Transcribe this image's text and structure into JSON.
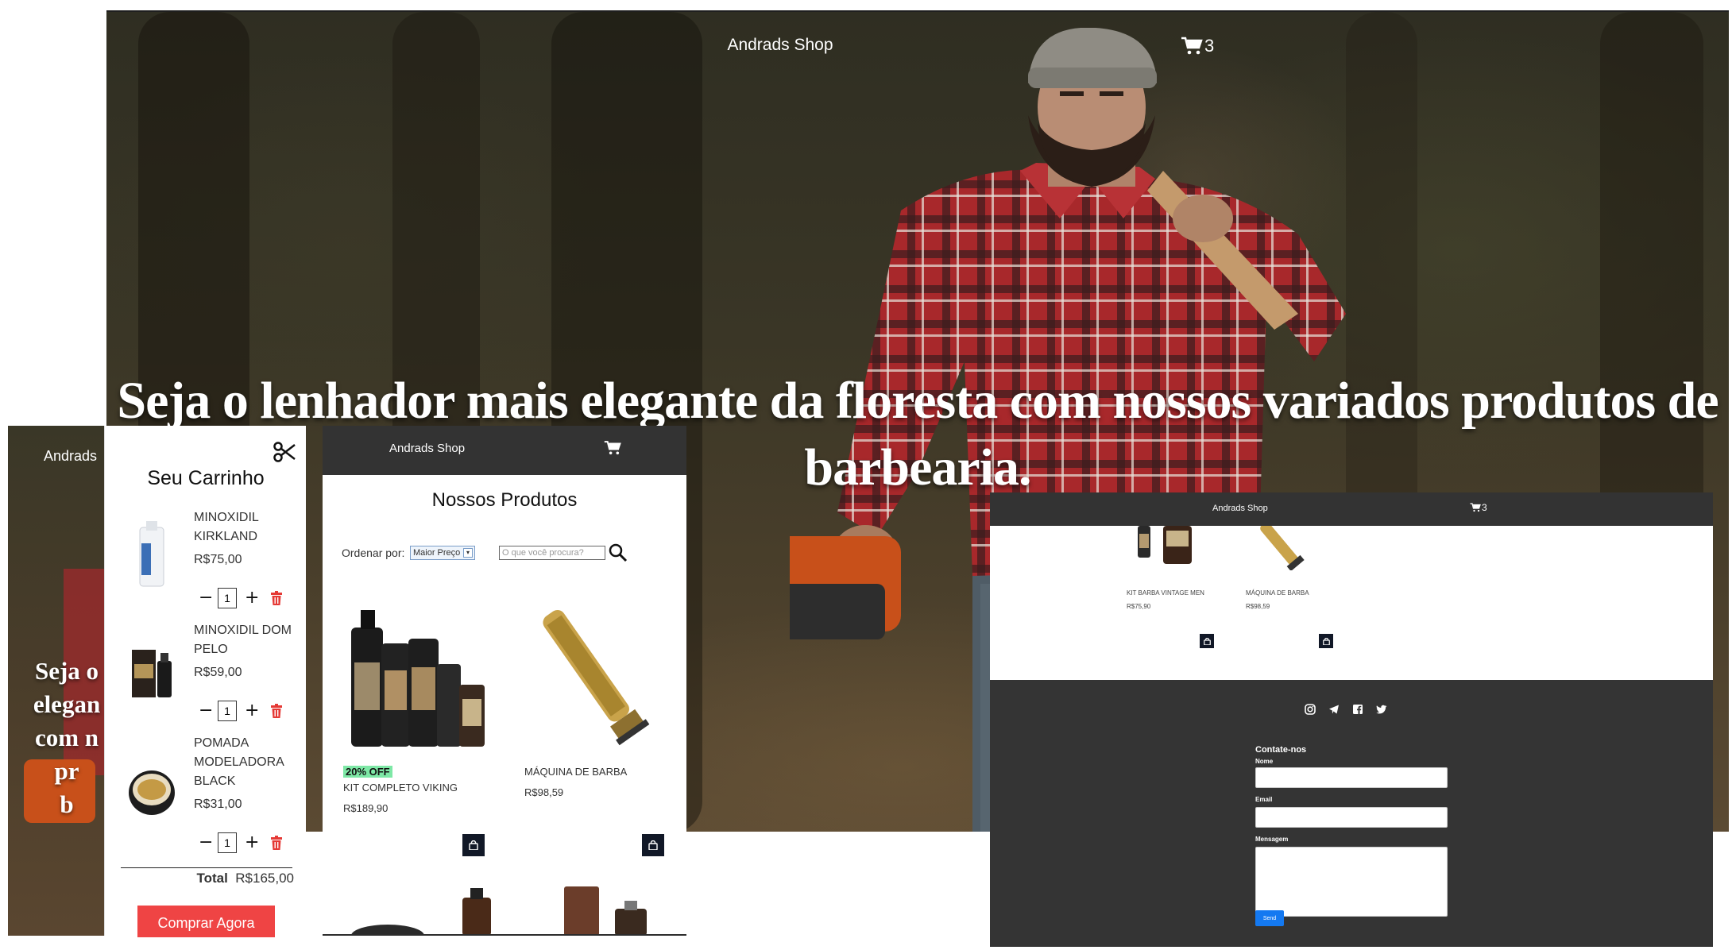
{
  "hero": {
    "brand": "Andrads Shop",
    "cart_count": "3",
    "headline": "Seja o lenhador mais elegante da floresta com nossos variados produtos de barbearia."
  },
  "mobile_hero": {
    "brand": "Andrads",
    "text_lines": [
      "Seja o",
      "elegan",
      "com n",
      "pr",
      "b"
    ]
  },
  "cart": {
    "title": "Seu Carrinho",
    "items": [
      {
        "name": "MINOXIDIL KIRKLAND",
        "price": "R$75,00",
        "qty": "1"
      },
      {
        "name": "MINOXIDIL DOM PELO",
        "price": "R$59,00",
        "qty": "1"
      },
      {
        "name": "POMADA MODELADORA BLACK",
        "price": "R$31,00",
        "qty": "1"
      }
    ],
    "total_label": "Total",
    "total_value": "R$165,00",
    "buy_label": "Comprar Agora"
  },
  "products": {
    "brand": "Andrads Shop",
    "title": "Nossos Produtos",
    "sort_label": "Ordenar por:",
    "sort_value": "Maior Preço",
    "search_placeholder": "O que você procura?",
    "items": [
      {
        "badge": "20% OFF",
        "name": "KIT COMPLETO VIKING",
        "price": "R$189,90"
      },
      {
        "name": "MÁQUINA DE BARBA",
        "price": "R$98,59"
      }
    ]
  },
  "shop": {
    "brand": "Andrads Shop",
    "cart_count": "3",
    "items": [
      {
        "name": "KIT BARBA VINTAGE MEN",
        "price": "R$75,90"
      },
      {
        "name": "MÁQUINA DE BARBA",
        "price": "R$98,59"
      }
    ],
    "social_icons": [
      "instagram-icon",
      "telegram-icon",
      "facebook-icon",
      "twitter-icon"
    ],
    "contact": {
      "title": "Contate-nos",
      "name_label": "Nome",
      "email_label": "Email",
      "message_label": "Mensagem",
      "send_label": "Send"
    }
  },
  "colors": {
    "nav_bg": "#333333",
    "footer_bg": "#343434",
    "buy_button": "#ef4444",
    "trash": "#e53935",
    "badge": "#7ee8a6",
    "send_button": "#1479f1",
    "bag_button": "#111827"
  }
}
